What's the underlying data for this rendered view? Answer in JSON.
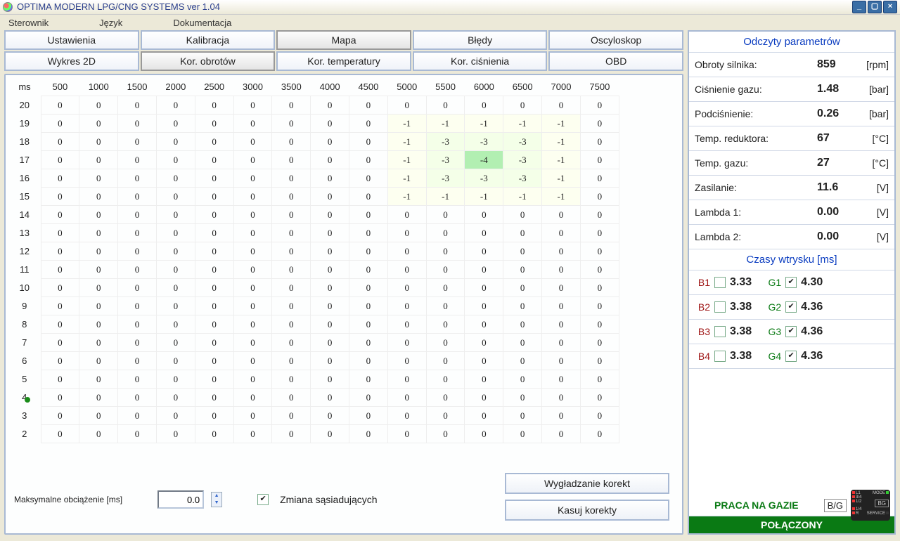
{
  "window": {
    "title": "OPTIMA MODERN LPG/CNG SYSTEMS ver 1.04"
  },
  "menu": {
    "controller": "Sterownik",
    "language": "Język",
    "docs": "Dokumentacja"
  },
  "tabs_top": {
    "settings": "Ustawienia",
    "calibration": "Kalibracja",
    "map": "Mapa",
    "errors": "Błędy",
    "oscilloscope": "Oscyloskop"
  },
  "tabs_sub": {
    "wykres": "Wykres 2D",
    "obroty": "Kor. obrotów",
    "temp": "Kor. temperatury",
    "press": "Kor. ciśnienia",
    "obd": "OBD"
  },
  "grid": {
    "corner": "ms",
    "cols": [
      "500",
      "1000",
      "1500",
      "2000",
      "2500",
      "3000",
      "3500",
      "4000",
      "4500",
      "5000",
      "5500",
      "6000",
      "6500",
      "7000",
      "7500"
    ],
    "rows": [
      "20",
      "19",
      "18",
      "17",
      "16",
      "15",
      "14",
      "13",
      "12",
      "11",
      "10",
      "9",
      "8",
      "7",
      "6",
      "5",
      "4",
      "3",
      "2"
    ],
    "cells": [
      [
        "0",
        "0",
        "0",
        "0",
        "0",
        "0",
        "0",
        "0",
        "0",
        "0",
        "0",
        "0",
        "0",
        "0",
        "0"
      ],
      [
        "0",
        "0",
        "0",
        "0",
        "0",
        "0",
        "0",
        "0",
        "0",
        "-1",
        "-1",
        "-1",
        "-1",
        "-1",
        "0"
      ],
      [
        "0",
        "0",
        "0",
        "0",
        "0",
        "0",
        "0",
        "0",
        "0",
        "-1",
        "-3",
        "-3",
        "-3",
        "-1",
        "0"
      ],
      [
        "0",
        "0",
        "0",
        "0",
        "0",
        "0",
        "0",
        "0",
        "0",
        "-1",
        "-3",
        "-4",
        "-3",
        "-1",
        "0"
      ],
      [
        "0",
        "0",
        "0",
        "0",
        "0",
        "0",
        "0",
        "0",
        "0",
        "-1",
        "-3",
        "-3",
        "-3",
        "-1",
        "0"
      ],
      [
        "0",
        "0",
        "0",
        "0",
        "0",
        "0",
        "0",
        "0",
        "0",
        "-1",
        "-1",
        "-1",
        "-1",
        "-1",
        "0"
      ],
      [
        "0",
        "0",
        "0",
        "0",
        "0",
        "0",
        "0",
        "0",
        "0",
        "0",
        "0",
        "0",
        "0",
        "0",
        "0"
      ],
      [
        "0",
        "0",
        "0",
        "0",
        "0",
        "0",
        "0",
        "0",
        "0",
        "0",
        "0",
        "0",
        "0",
        "0",
        "0"
      ],
      [
        "0",
        "0",
        "0",
        "0",
        "0",
        "0",
        "0",
        "0",
        "0",
        "0",
        "0",
        "0",
        "0",
        "0",
        "0"
      ],
      [
        "0",
        "0",
        "0",
        "0",
        "0",
        "0",
        "0",
        "0",
        "0",
        "0",
        "0",
        "0",
        "0",
        "0",
        "0"
      ],
      [
        "0",
        "0",
        "0",
        "0",
        "0",
        "0",
        "0",
        "0",
        "0",
        "0",
        "0",
        "0",
        "0",
        "0",
        "0"
      ],
      [
        "0",
        "0",
        "0",
        "0",
        "0",
        "0",
        "0",
        "0",
        "0",
        "0",
        "0",
        "0",
        "0",
        "0",
        "0"
      ],
      [
        "0",
        "0",
        "0",
        "0",
        "0",
        "0",
        "0",
        "0",
        "0",
        "0",
        "0",
        "0",
        "0",
        "0",
        "0"
      ],
      [
        "0",
        "0",
        "0",
        "0",
        "0",
        "0",
        "0",
        "0",
        "0",
        "0",
        "0",
        "0",
        "0",
        "0",
        "0"
      ],
      [
        "0",
        "0",
        "0",
        "0",
        "0",
        "0",
        "0",
        "0",
        "0",
        "0",
        "0",
        "0",
        "0",
        "0",
        "0"
      ],
      [
        "0",
        "0",
        "0",
        "0",
        "0",
        "0",
        "0",
        "0",
        "0",
        "0",
        "0",
        "0",
        "0",
        "0",
        "0"
      ],
      [
        "0",
        "0",
        "0",
        "0",
        "0",
        "0",
        "0",
        "0",
        "0",
        "0",
        "0",
        "0",
        "0",
        "0",
        "0"
      ],
      [
        "0",
        "0",
        "0",
        "0",
        "0",
        "0",
        "0",
        "0",
        "0",
        "0",
        "0",
        "0",
        "0",
        "0",
        "0"
      ],
      [
        "0",
        "0",
        "0",
        "0",
        "0",
        "0",
        "0",
        "0",
        "0",
        "0",
        "0",
        "0",
        "0",
        "0",
        "0"
      ]
    ],
    "marker_row": 16
  },
  "bottom": {
    "maxload_label": "Maksymalne obciążenie [ms]",
    "maxload_value": "0.0",
    "neighbor_label": "Zmiana sąsiadujących",
    "smooth_btn": "Wygładzanie korekt",
    "clear_btn": "Kasuj korekty"
  },
  "readings": {
    "title": "Odczyty parametrów",
    "items": [
      {
        "label": "Obroty silnika:",
        "value": "859",
        "unit": "[rpm]"
      },
      {
        "label": "Ciśnienie gazu:",
        "value": "1.48",
        "unit": "[bar]"
      },
      {
        "label": "Podciśnienie:",
        "value": "0.26",
        "unit": "[bar]"
      },
      {
        "label": "Temp. reduktora:",
        "value": "67",
        "unit": "[°C]"
      },
      {
        "label": "Temp. gazu:",
        "value": "27",
        "unit": "[°C]"
      },
      {
        "label": "Zasilanie:",
        "value": "11.6",
        "unit": "[V]"
      },
      {
        "label": "Lambda 1:",
        "value": "0.00",
        "unit": "[V]"
      },
      {
        "label": "Lambda 2:",
        "value": "0.00",
        "unit": "[V]"
      }
    ]
  },
  "injection": {
    "title": "Czasy wtrysku [ms]",
    "rows": [
      {
        "bl": "B1",
        "bv": "3.33",
        "gl": "G1",
        "gv": "4.30",
        "bc": false,
        "gc": true
      },
      {
        "bl": "B2",
        "bv": "3.38",
        "gl": "G2",
        "gv": "4.36",
        "bc": false,
        "gc": true
      },
      {
        "bl": "B3",
        "bv": "3.38",
        "gl": "G3",
        "gv": "4.36",
        "bc": false,
        "gc": true
      },
      {
        "bl": "B4",
        "bv": "3.38",
        "gl": "G4",
        "gv": "4.36",
        "bc": false,
        "gc": true
      }
    ]
  },
  "status": {
    "mode": "PRACA NA GAZIE",
    "bg": "B/G",
    "connected": "POŁĄCZONY"
  }
}
